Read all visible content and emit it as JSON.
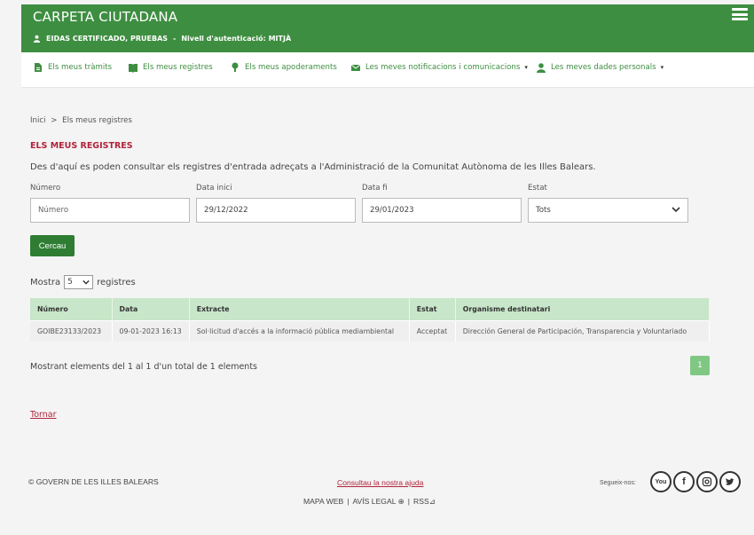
{
  "header": {
    "title": "CARPETA CIUTADANA",
    "user": "EIDAS CERTIFICADO, PRUEBAS",
    "auth_level": "Nivell d'autenticació: MITJÀ",
    "brand_color": "#3e8e41"
  },
  "nav": {
    "items": [
      {
        "label": "Els meus tràmits",
        "icon": "document-icon"
      },
      {
        "label": "Els meus registres",
        "icon": "book-icon"
      },
      {
        "label": "Els meus apoderaments",
        "icon": "person-pin-icon"
      },
      {
        "label": "Les meves notificacions i comunicacions",
        "icon": "envelope-icon",
        "dropdown": true
      },
      {
        "label": "Les meves dades personals",
        "icon": "user-icon",
        "dropdown": true
      }
    ]
  },
  "breadcrumb": {
    "home": "Inici",
    "separator": ">",
    "current": "Els meus registres"
  },
  "page": {
    "title": "ELS MEUS REGISTRES",
    "intro": "Des d'aquí es poden consultar els registres d'entrada adreçats a l'Administració de la Comunitat Autònoma de les Illes Balears."
  },
  "filters": {
    "numero_label": "Número",
    "numero_placeholder": "Número",
    "data_inici_label": "Data inici",
    "data_inici_value": "29/12/2022",
    "data_fi_label": "Data fi",
    "data_fi_value": "29/01/2023",
    "estat_label": "Estat",
    "estat_value": "Tots",
    "search_button": "Cercau"
  },
  "table_controls": {
    "show_prefix": "Mostra",
    "show_value": "5",
    "show_suffix": "registres"
  },
  "table": {
    "headers": [
      "Número",
      "Data",
      "Extracte",
      "Estat",
      "Organisme destinatari"
    ],
    "rows": [
      [
        "GOIBE23133/2023",
        "09-01-2023 16:13",
        "Sol·licitud d'accés a la informació pública mediambiental",
        "Acceptat",
        "Dirección General de Participación, Transparencia y Voluntariado"
      ]
    ]
  },
  "pagination": {
    "summary": "Mostrant elements del 1 al 1 d'un total de 1 elements",
    "current_page": "1"
  },
  "back_link": "Tornar",
  "footer": {
    "copyright": "© GOVERN DE LES ILLES BALEARS",
    "help": "Consultau la nostra ajuda",
    "map": "MAPA WEB",
    "legal": "AVÍS LEGAL",
    "rss": "RSS",
    "sep": "|",
    "follow": "Segueix-nos:",
    "social": [
      "youtube-icon",
      "facebook-icon",
      "instagram-icon",
      "twitter-icon"
    ]
  }
}
